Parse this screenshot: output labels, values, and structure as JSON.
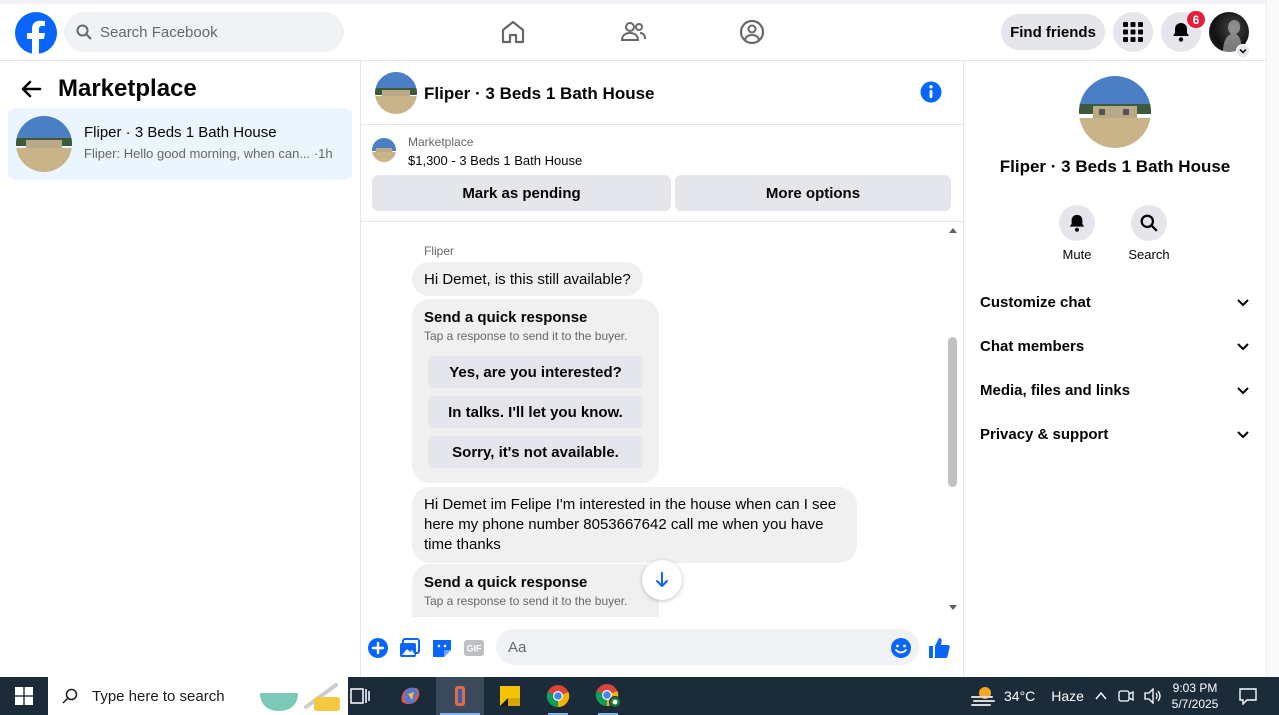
{
  "topbar": {
    "search_placeholder": "Search Facebook",
    "find_friends": "Find friends",
    "notifications_count": "6"
  },
  "left": {
    "title": "Marketplace",
    "conversation": {
      "title": "Fliper · 3 Beds 1 Bath House",
      "snippet": "Fliper: Hello good morning, when can... ·1h"
    }
  },
  "chat": {
    "header_title": "Fliper · 3 Beds 1 Bath House",
    "listing": {
      "kicker": "Marketplace",
      "price_title": "$1,300 - 3 Beds 1 Bath House",
      "mark_pending": "Mark as pending",
      "more_options": "More options"
    },
    "sender_name": "Fliper",
    "messages": [
      "Hi Demet, is this still available?",
      "Hi Demet im Felipe I'm interested in the house when can I see here my phone number 8053667642 call me when you have time thanks"
    ],
    "quick_response": {
      "title": "Send a quick response",
      "subtitle": "Tap a response to send it to the buyer.",
      "options": [
        "Yes, are you interested?",
        "In talks. I'll let you know.",
        "Sorry, it's not available."
      ]
    },
    "composer_placeholder": "Aa"
  },
  "right": {
    "title": "Fliper · 3 Beds 1 Bath House",
    "mute": "Mute",
    "search": "Search",
    "sections": [
      "Customize chat",
      "Chat members",
      "Media, files and links",
      "Privacy & support"
    ]
  },
  "taskbar": {
    "search_placeholder": "Type here to search",
    "weather": "34°C",
    "weather_desc": "Haze",
    "time": "9:03 PM",
    "date": "5/7/2025"
  },
  "colors": {
    "brand": "#0866ff",
    "selected_bg": "#ebf5ff",
    "button_grey": "#e4e6eb",
    "badge_red": "#e41e3f"
  }
}
